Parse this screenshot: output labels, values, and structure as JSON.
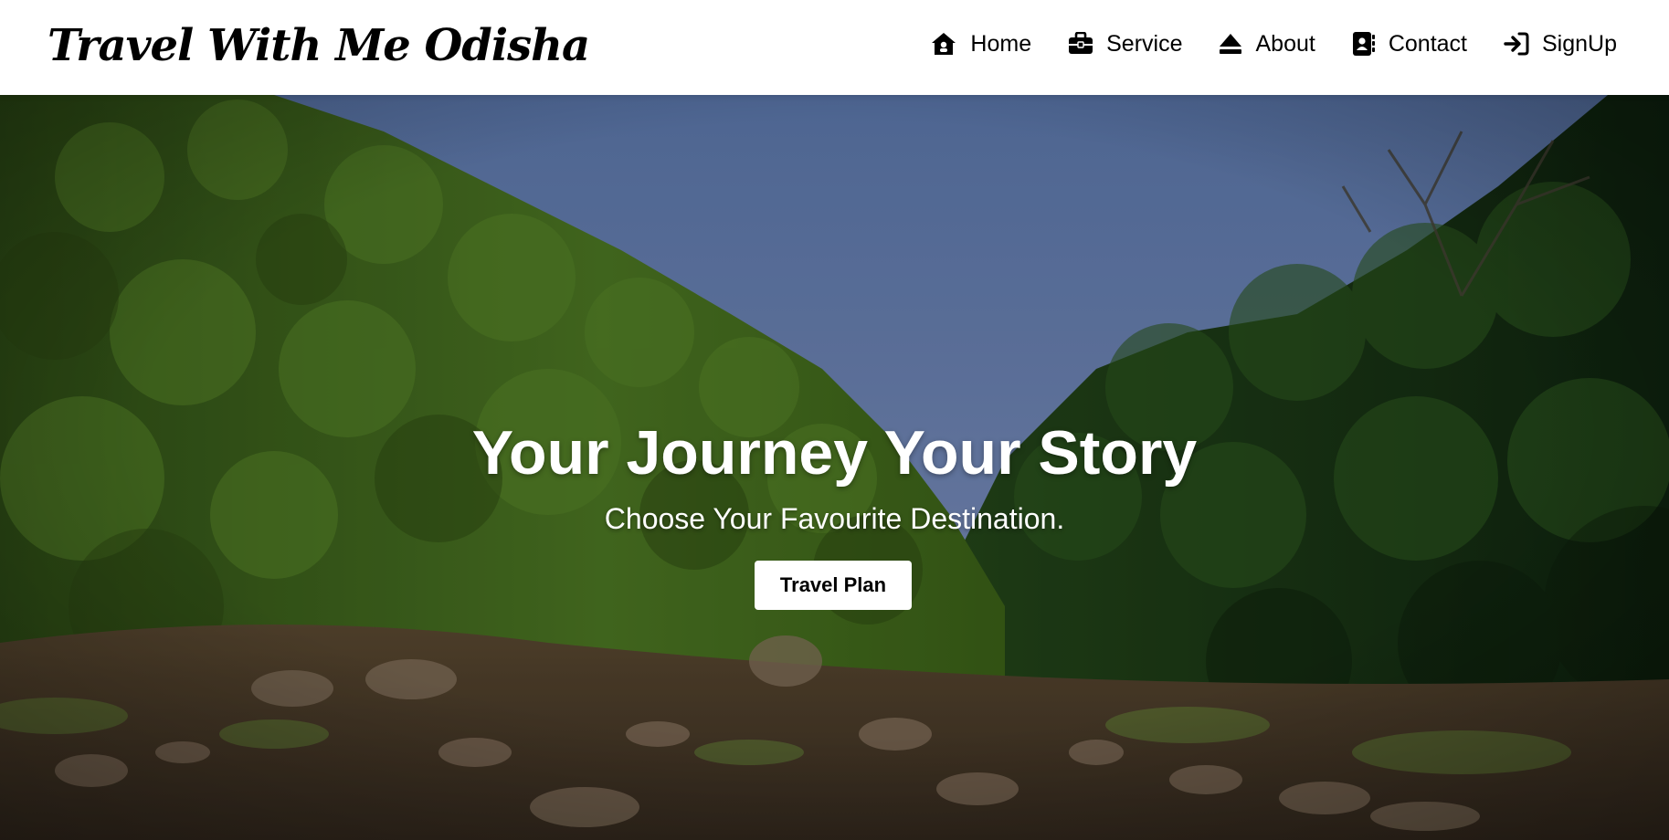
{
  "brand": {
    "title": "Travel With Me Odisha"
  },
  "nav": {
    "items": [
      {
        "label": "Home",
        "icon": "home-icon"
      },
      {
        "label": "Service",
        "icon": "briefcase-icon"
      },
      {
        "label": "About",
        "icon": "eject-icon"
      },
      {
        "label": "Contact",
        "icon": "address-book-icon"
      },
      {
        "label": "SignUp",
        "icon": "sign-in-icon"
      }
    ]
  },
  "hero": {
    "title": "Your Journey Your Story",
    "subtitle": "Choose Your Favourite Destination.",
    "button_label": "Travel Plan",
    "background": "forest-valley-photo"
  },
  "colors": {
    "navbar_bg": "#ffffff",
    "text_dark": "#000000",
    "hero_text": "#ffffff",
    "sky": "#6a83b4",
    "forest": "#3f6a1e"
  }
}
